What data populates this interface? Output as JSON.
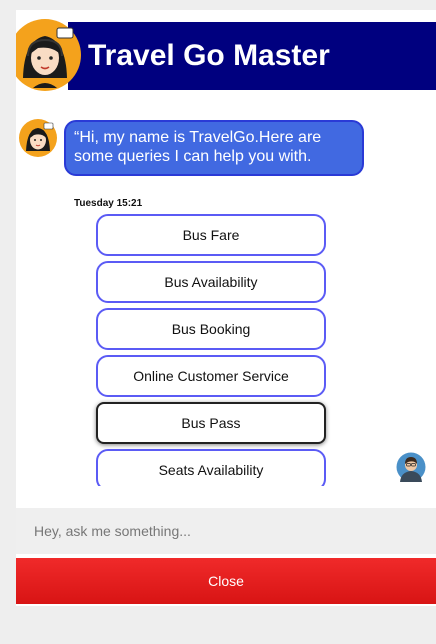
{
  "header": {
    "title": "Travel Go Master"
  },
  "chat": {
    "bot_message": "“Hi, my name is TravelGo.Here are some queries I can help you with.",
    "timestamp": "Tuesday 15:21",
    "options": [
      {
        "label": "Bus Fare"
      },
      {
        "label": "Bus Availability"
      },
      {
        "label": "Bus Booking"
      },
      {
        "label": "Online Customer Service"
      },
      {
        "label": "Bus Pass"
      },
      {
        "label": "Seats Availability"
      }
    ]
  },
  "input": {
    "placeholder": "Hey, ask me something..."
  },
  "footer": {
    "close_label": "Close"
  },
  "colors": {
    "header_bg": "#00007f",
    "bubble_bg": "#4169e1",
    "option_border": "#5b5bf5",
    "close_bg": "#e41e1e"
  }
}
